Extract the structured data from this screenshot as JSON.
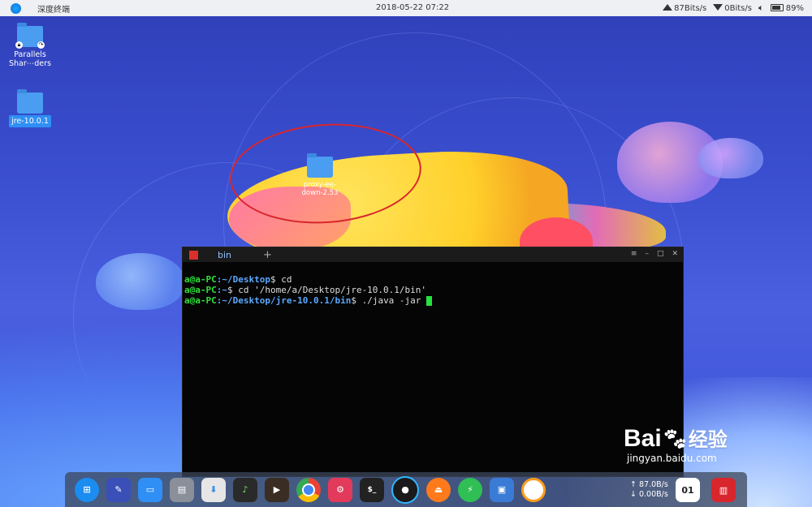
{
  "topbar": {
    "app_name": "深度终端",
    "datetime": "2018-05-22 07:22",
    "upload": "87Bits/s",
    "download": "0Bits/s",
    "battery": "89%"
  },
  "desktop": {
    "icons": [
      {
        "label": "Parallels Shar⋯ders"
      },
      {
        "label": "jre-10.0.1"
      },
      {
        "label": "proxy-ee-down-2.53"
      }
    ]
  },
  "terminal": {
    "tab_label": "bin",
    "lines": [
      {
        "user": "a@a-PC",
        "path": ":~/Desktop",
        "cmd": "$ cd"
      },
      {
        "user": "a@a-PC",
        "path": ":~",
        "cmd": "$ cd '/home/a/Desktop/jre-10.0.1/bin'"
      },
      {
        "user": "a@a-PC",
        "path": ":~/Desktop/jre-10.0.1/bin",
        "cmd": "$ ./java -jar "
      }
    ],
    "controls": [
      "≡",
      "–",
      "□",
      "✕"
    ]
  },
  "dock": {
    "items": [
      {
        "name": "launcher",
        "color": "#1b8cf0"
      },
      {
        "name": "editor",
        "color": "#3a4fb8"
      },
      {
        "name": "multitasking",
        "color": "#2f8ff5"
      },
      {
        "name": "file-manager",
        "color": "#8a8f99"
      },
      {
        "name": "app-store",
        "color": "#e6e6e6"
      },
      {
        "name": "music",
        "color": "#2a2a2a"
      },
      {
        "name": "movie",
        "color": "#3a2d24"
      },
      {
        "name": "chrome",
        "color": "#ffffff"
      },
      {
        "name": "settings",
        "color": "#e23a5a"
      },
      {
        "name": "terminal",
        "color": "#222222"
      },
      {
        "name": "screen-recorder",
        "color": "#1a1a1a"
      },
      {
        "name": "installer",
        "color": "#ff7a1a"
      },
      {
        "name": "power-manager",
        "color": "#2fbf55"
      },
      {
        "name": "network-folder",
        "color": "#3a7bd5"
      },
      {
        "name": "deepin-clone",
        "color": "#ff9c1a"
      }
    ],
    "net_up": "↑ 87.0B/s",
    "net_down": "↓ 0.00B/s",
    "calendar_day": "01",
    "trash_color": "#d8262c"
  },
  "watermark": {
    "brand": "Bai",
    "brand_tail": "经验",
    "url": "jingyan.baidu.com"
  }
}
